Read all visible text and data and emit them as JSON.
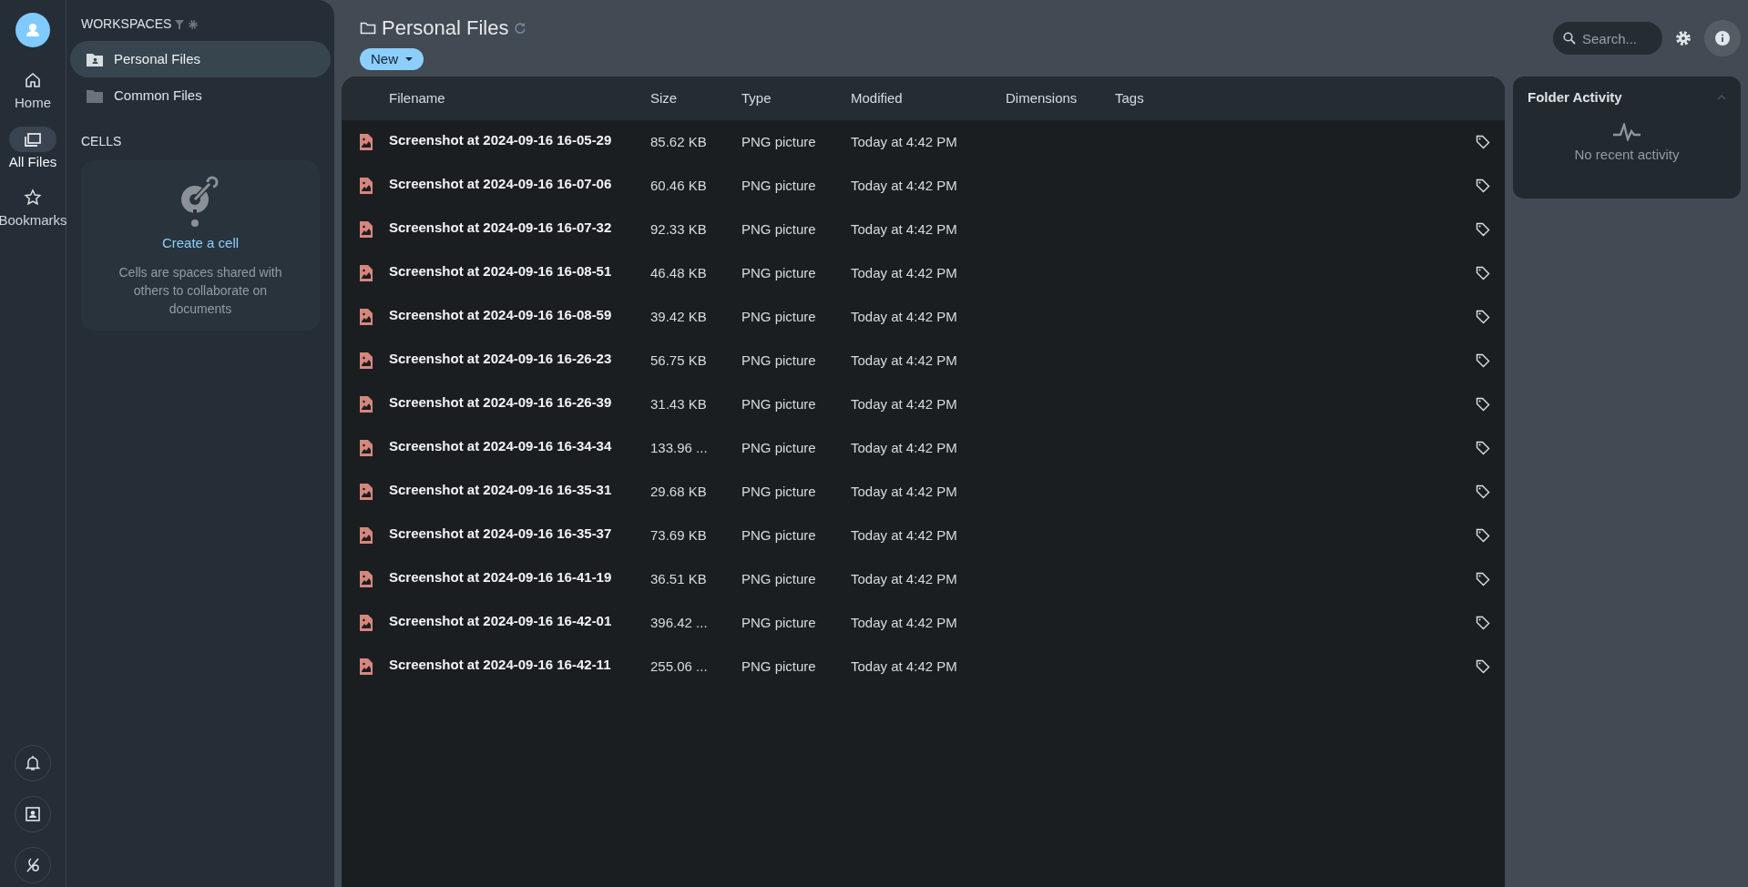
{
  "rail": {
    "items": [
      {
        "label": "Home",
        "selected": false
      },
      {
        "label": "All Files",
        "selected": true
      },
      {
        "label": "Bookmarks",
        "selected": false
      }
    ]
  },
  "sidebar": {
    "workspaces_title": "WORKSPACES",
    "workspaces": [
      {
        "label": "Personal Files",
        "selected": true
      },
      {
        "label": "Common Files",
        "selected": false
      }
    ],
    "cells_title": "CELLS",
    "cells_card": {
      "link": "Create a cell",
      "description": "Cells are spaces shared with others to collaborate on documents"
    }
  },
  "header": {
    "title": "Personal Files",
    "new_button": "New",
    "search": {
      "placeholder": "Search..."
    }
  },
  "table": {
    "columns": [
      "Filename",
      "Size",
      "Type",
      "Modified",
      "Dimensions",
      "Tags"
    ],
    "rows": [
      {
        "name": "Screenshot at 2024-09-16 16-05-29",
        "size": "85.62 KB",
        "type": "PNG picture",
        "modified": "Today at 4:42 PM"
      },
      {
        "name": "Screenshot at 2024-09-16 16-07-06",
        "size": "60.46 KB",
        "type": "PNG picture",
        "modified": "Today at 4:42 PM"
      },
      {
        "name": "Screenshot at 2024-09-16 16-07-32",
        "size": "92.33 KB",
        "type": "PNG picture",
        "modified": "Today at 4:42 PM"
      },
      {
        "name": "Screenshot at 2024-09-16 16-08-51",
        "size": "46.48 KB",
        "type": "PNG picture",
        "modified": "Today at 4:42 PM"
      },
      {
        "name": "Screenshot at 2024-09-16 16-08-59",
        "size": "39.42 KB",
        "type": "PNG picture",
        "modified": "Today at 4:42 PM"
      },
      {
        "name": "Screenshot at 2024-09-16 16-26-23",
        "size": "56.75 KB",
        "type": "PNG picture",
        "modified": "Today at 4:42 PM"
      },
      {
        "name": "Screenshot at 2024-09-16 16-26-39",
        "size": "31.43 KB",
        "type": "PNG picture",
        "modified": "Today at 4:42 PM"
      },
      {
        "name": "Screenshot at 2024-09-16 16-34-34",
        "size": "133.96 ...",
        "type": "PNG picture",
        "modified": "Today at 4:42 PM"
      },
      {
        "name": "Screenshot at 2024-09-16 16-35-31",
        "size": "29.68 KB",
        "type": "PNG picture",
        "modified": "Today at 4:42 PM"
      },
      {
        "name": "Screenshot at 2024-09-16 16-35-37",
        "size": "73.69 KB",
        "type": "PNG picture",
        "modified": "Today at 4:42 PM"
      },
      {
        "name": "Screenshot at 2024-09-16 16-41-19",
        "size": "36.51 KB",
        "type": "PNG picture",
        "modified": "Today at 4:42 PM"
      },
      {
        "name": "Screenshot at 2024-09-16 16-42-01",
        "size": "396.42 ...",
        "type": "PNG picture",
        "modified": "Today at 4:42 PM"
      },
      {
        "name": "Screenshot at 2024-09-16 16-42-11",
        "size": "255.06 ...",
        "type": "PNG picture",
        "modified": "Today at 4:42 PM"
      }
    ]
  },
  "activity": {
    "title": "Folder Activity",
    "expanded": true,
    "empty_text": "No recent activity"
  }
}
